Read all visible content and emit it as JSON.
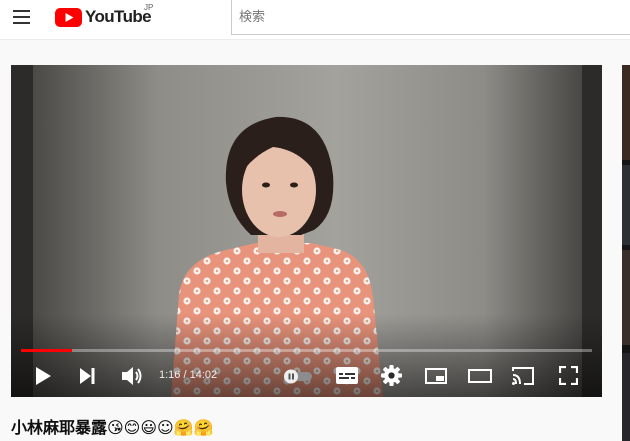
{
  "header": {
    "logo_text": "YouTube",
    "country_code": "JP",
    "search_placeholder": "検索",
    "brand_red": "#ff0000"
  },
  "player": {
    "current_time": "1:16",
    "duration": "14:02",
    "time_display": "1:16 / 14:02",
    "progress_fraction": 0.09,
    "autoplay_on": false,
    "frame_description": "woman in pink sweater with white flower pattern speaking to camera in front of grey wall"
  },
  "video": {
    "title": "小林麻耶暴露😘😊😃☺🤗🤗"
  }
}
